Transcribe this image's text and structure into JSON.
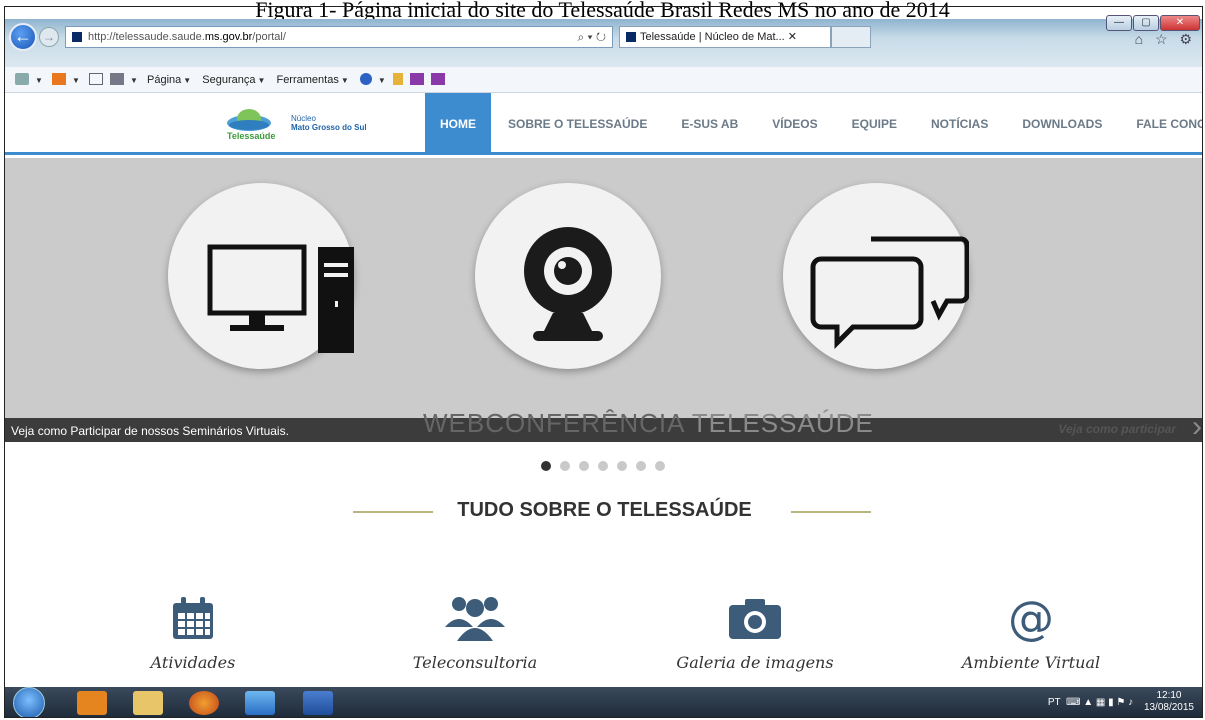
{
  "caption": "Figura 1- Página inicial do site do Telessaúde Brasil Redes MS no ano de 2014",
  "browser": {
    "address_prefix": "http://telessaude.saude.",
    "address_domain": "ms.gov.br",
    "address_suffix": "/portal/",
    "address_tools": "⌕ ▾ ↻",
    "tab_title": "Telessaúde | Núcleo de Mat... ✕",
    "minimize": "—",
    "maximize": "▢",
    "close": "✕",
    "right_icons": "⌂ ☆ ⚙"
  },
  "cmdbar": {
    "pagina": "Página",
    "seguranca": "Segurança",
    "ferramentas": "Ferramentas"
  },
  "logo": {
    "brand": "Telessaúde",
    "nucleo": "Núcleo",
    "mgs": "Mato Grosso do Sul"
  },
  "menu": [
    "HOME",
    "SOBRE O TELESSAÚDE",
    "E-SUS AB",
    "VÍDEOS",
    "EQUIPE",
    "NOTÍCIAS",
    "DOWNLOADS",
    "FALE CONOSCO"
  ],
  "slider": {
    "caption": "Veja como Participar de nossos Seminários Virtuais.",
    "big_part1": "WEBCONFERÊNCIA",
    "big_part2": " TELESSAÚDE",
    "more": "Veja como participar",
    "dots_total": 7,
    "dots_active": 1
  },
  "section_title": "TUDO SOBRE O TELESSAÚDE",
  "features": [
    {
      "label": "Atividades",
      "icon": "calendar-icon"
    },
    {
      "label": "Teleconsultoria",
      "icon": "users-icon"
    },
    {
      "label": "Galeria de imagens",
      "icon": "camera-icon"
    },
    {
      "label": "Ambiente Virtual",
      "icon": "at-icon"
    }
  ],
  "taskbar": {
    "lang": "PT",
    "time": "12:10",
    "date": "13/08/2015"
  },
  "colors": {
    "accent": "#3d8ccf",
    "icon": "#3c5c7a",
    "title_line": "#b8b581"
  }
}
